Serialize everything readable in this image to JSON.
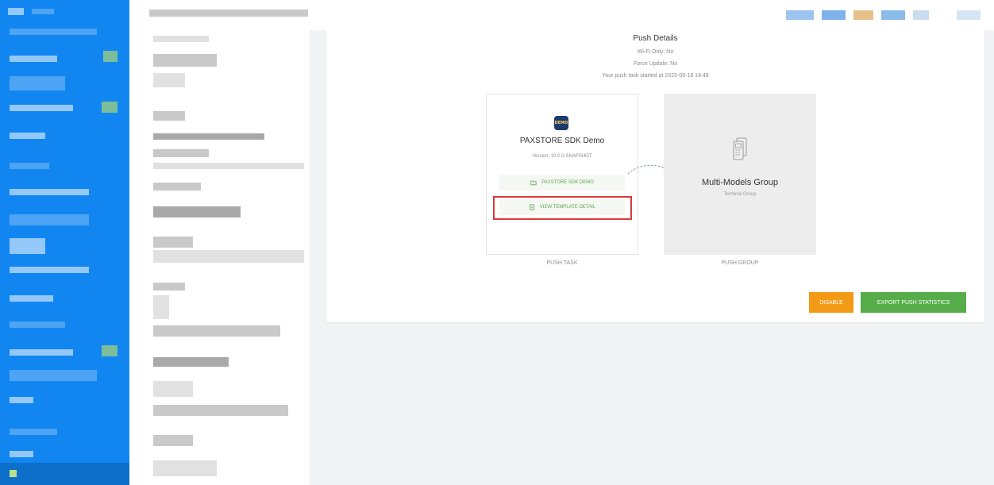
{
  "push_details": {
    "title": "Push Details",
    "wifi_only": "Wi-Fi Only: No",
    "force_update": "Force Update: No",
    "started": "Your push task started at 2025-09-18 18:48"
  },
  "task": {
    "icon_text": "DEMO",
    "app_name": "PAXSTORE SDK Demo",
    "version": "Version: 10.0.0-SNAPSHOT",
    "link_app": "PAXSTORE SDK DEMO",
    "link_template": "VIEW TEMPLATE DETAIL",
    "label": "PUSH TASK"
  },
  "group": {
    "name": "Multi-Models Group",
    "sub": "Terminal Group",
    "label": "PUSH GROUP"
  },
  "actions": {
    "disable": "DISABLE",
    "export": "EXPORT PUSH STATISTICS"
  },
  "colors": {
    "sidebar": "#1286f0",
    "link_green": "#59a84b",
    "disable_orange": "#f39a16",
    "export_green": "#56ad4a",
    "highlight_red": "#d93a3a"
  }
}
